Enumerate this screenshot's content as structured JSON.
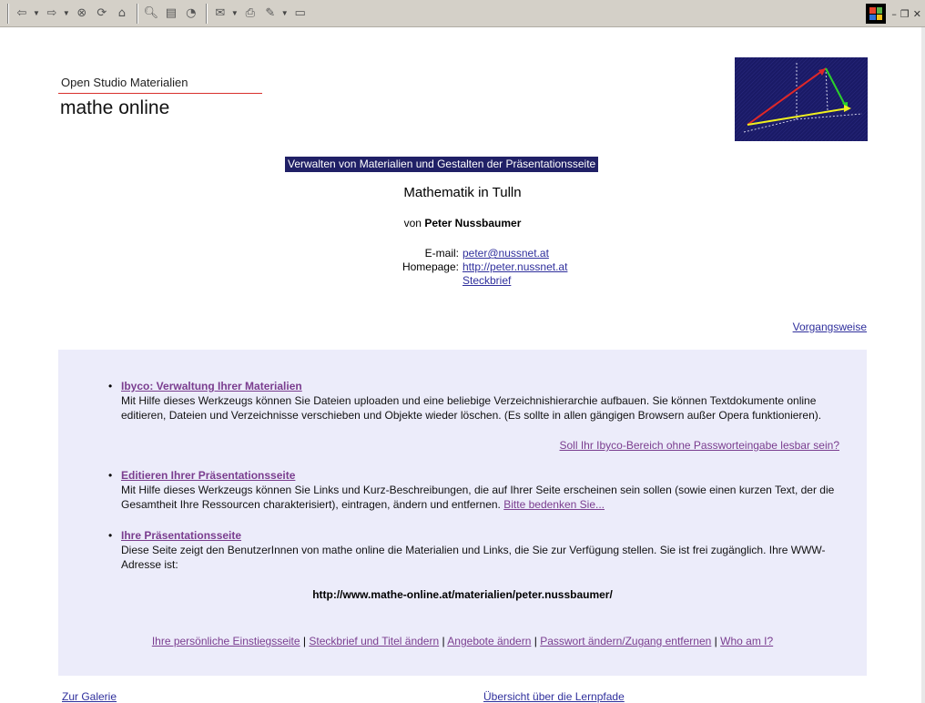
{
  "toolbar": {
    "icons": [
      "back-icon",
      "forward-icon",
      "stop-icon",
      "refresh-icon",
      "home-icon",
      "search-icon",
      "favorites-icon",
      "history-icon",
      "mail-icon",
      "print-icon",
      "edit-icon",
      "discuss-icon"
    ]
  },
  "header": {
    "brand_small": "Open Studio Materialien",
    "brand_big": "mathe online"
  },
  "banner": "Verwalten von Materialien und Gestalten der Präsentationsseite",
  "page_title": "Mathematik in Tulln",
  "author": {
    "prefix": "von",
    "name": "Peter Nussbaumer"
  },
  "contact": {
    "email_label": "E-mail:",
    "email_value": "peter@nussnet.at",
    "homepage_label": "Homepage:",
    "homepage_value": "http://peter.nussnet.at",
    "profile_link": "Steckbrief"
  },
  "procedure_link": "Vorgangsweise",
  "items": [
    {
      "title": "Ibyco: Verwaltung Ihrer Materialien",
      "desc": "Mit Hilfe dieses Werkzeugs können Sie Dateien uploaden und eine beliebige Verzeichnishierarchie aufbauen. Sie können Textdokumente online editieren, Dateien und Verzeichnisse verschieben und Objekte wieder löschen. (Es sollte in allen gängigen Browsern außer Opera funktionieren).",
      "extra_link": "Soll Ihr Ibyco-Bereich ohne Passworteingabe lesbar sein?"
    },
    {
      "title": "Editieren Ihrer Präsentationsseite",
      "desc": "Mit Hilfe dieses Werkzeugs können Sie Links und Kurz-Beschreibungen, die auf Ihrer Seite erscheinen sein sollen (sowie einen kurzen Text, der die Gesamtheit Ihre Ressourcen charakterisiert), eintragen, ändern und entfernen.",
      "extra_link": "Bitte bedenken Sie..."
    },
    {
      "title": "Ihre Präsentationsseite",
      "desc": "Diese Seite zeigt den BenutzerInnen von mathe online die Materialien und Links, die Sie zur Verfügung stellen. Sie ist frei zugänglich. Ihre WWW-Adresse ist:"
    }
  ],
  "presentation_url": "http://www.mathe-online.at/materialien/peter.nussbaumer/",
  "footer_links": [
    "Ihre persönliche Einstiegsseite",
    "Steckbrief und Titel ändern",
    "Angebote ändern",
    "Passwort ändern/Zugang entfernen",
    "Who am I?"
  ],
  "footer_separator": "|",
  "bottom": {
    "gallery": "Zur Galerie",
    "overview": "Übersicht über die Lernpfade"
  },
  "colors": {
    "panel_bg": "#ececfa",
    "banner_bg": "#202066",
    "link": "#2f2f9c",
    "visited": "#7a3d8f",
    "brand_rule": "#d9302c"
  }
}
